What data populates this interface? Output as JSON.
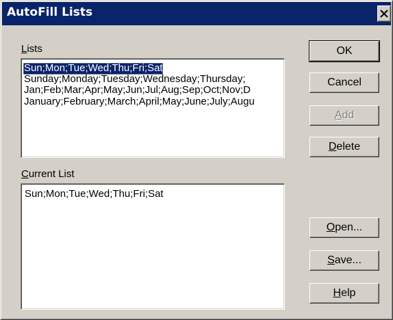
{
  "window": {
    "title": "AutoFill Lists"
  },
  "lists": {
    "label_accel": "L",
    "label_rest": "ists",
    "items": [
      {
        "text": "Sun;Mon;Tue;Wed;Thu;Fri;Sat",
        "selected": true
      },
      {
        "text": "Sunday;Monday;Tuesday;Wednesday;Thursday;",
        "selected": false
      },
      {
        "text": "Jan;Feb;Mar;Apr;May;Jun;Jul;Aug;Sep;Oct;Nov;D",
        "selected": false
      },
      {
        "text": "January;February;March;April;May;June;July;Augu",
        "selected": false
      }
    ]
  },
  "current_list": {
    "label_accel": "C",
    "label_rest": "urrent List",
    "value": "Sun;Mon;Tue;Wed;Thu;Fri;Sat"
  },
  "buttons": {
    "ok": "OK",
    "cancel": "Cancel",
    "add_accel": "A",
    "add_rest": "dd",
    "delete_accel": "D",
    "delete_rest": "elete",
    "open_accel": "O",
    "open_rest": "pen...",
    "save_accel": "S",
    "save_rest": "ave...",
    "help_accel": "H",
    "help_rest": "elp"
  },
  "icons": {
    "close": "close-icon"
  },
  "colors": {
    "titlebar": "#0a246a",
    "face": "#d4d0c8",
    "selection": "#0a246a"
  }
}
